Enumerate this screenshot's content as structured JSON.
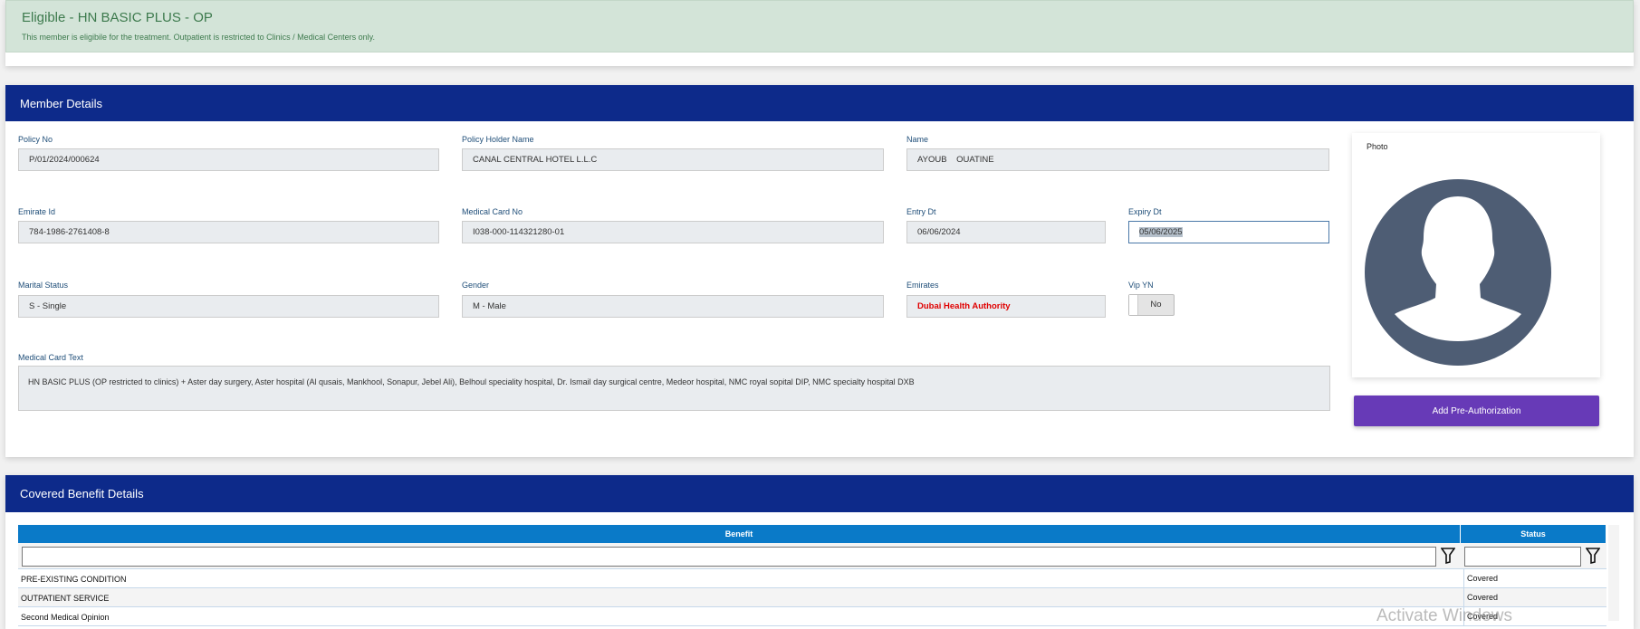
{
  "alert": {
    "title": "Eligible - HN BASIC PLUS - OP",
    "message": "This member is eligibile for the treatment. Outpatient is restricted to Clinics / Medical Centers only."
  },
  "member": {
    "header": "Member Details",
    "policy_no": {
      "label": "Policy No",
      "value": "P/01/2024/000624"
    },
    "policy_holder": {
      "label": "Policy Holder Name",
      "value": "CANAL CENTRAL HOTEL L.L.C"
    },
    "name": {
      "label": "Name",
      "value": "AYOUB    OUATINE"
    },
    "emirate_id": {
      "label": "Emirate Id",
      "value": "784-1986-2761408-8"
    },
    "medical_card_no": {
      "label": "Medical Card No",
      "value": "I038-000-114321280-01"
    },
    "entry_dt": {
      "label": "Entry Dt",
      "value": "06/06/2024"
    },
    "expiry_dt": {
      "label": "Expiry Dt",
      "value": "05/06/2025"
    },
    "marital_status": {
      "label": "Marital Status",
      "value": "S - Single"
    },
    "gender": {
      "label": "Gender",
      "value": "M - Male"
    },
    "emirates": {
      "label": "Emirates",
      "value": "Dubai Health Authority"
    },
    "vip": {
      "label": "Vip YN",
      "value": "No"
    },
    "medical_card_text": {
      "label": "Medical Card Text",
      "value": "HN BASIC PLUS (OP restricted to clinics) + Aster day surgery, Aster hospital (Al qusais, Mankhool, Sonapur, Jebel Ali), Belhoul speciality hospital, Dr. Ismail day surgical centre, Medeor hospital, NMC royal sopital DIP,  NMC specialty hospital DXB"
    },
    "photo_label": "Photo",
    "add_preauth": "Add Pre-Authorization"
  },
  "benefits": {
    "header": "Covered Benefit Details",
    "columns": [
      "Benefit",
      "Status"
    ],
    "rows": [
      {
        "benefit": "PRE-EXISTING CONDITION",
        "status": "Covered"
      },
      {
        "benefit": "OUTPATIENT SERVICE",
        "status": "Covered"
      },
      {
        "benefit": "Second Medical Opinion",
        "status": "Covered"
      }
    ]
  },
  "watermark": "Activate Windows",
  "colors": {
    "header": "#0d2a8a",
    "button": "#673ab7",
    "grid_header": "#0a7ac8",
    "emirates_text": "#e00000"
  }
}
